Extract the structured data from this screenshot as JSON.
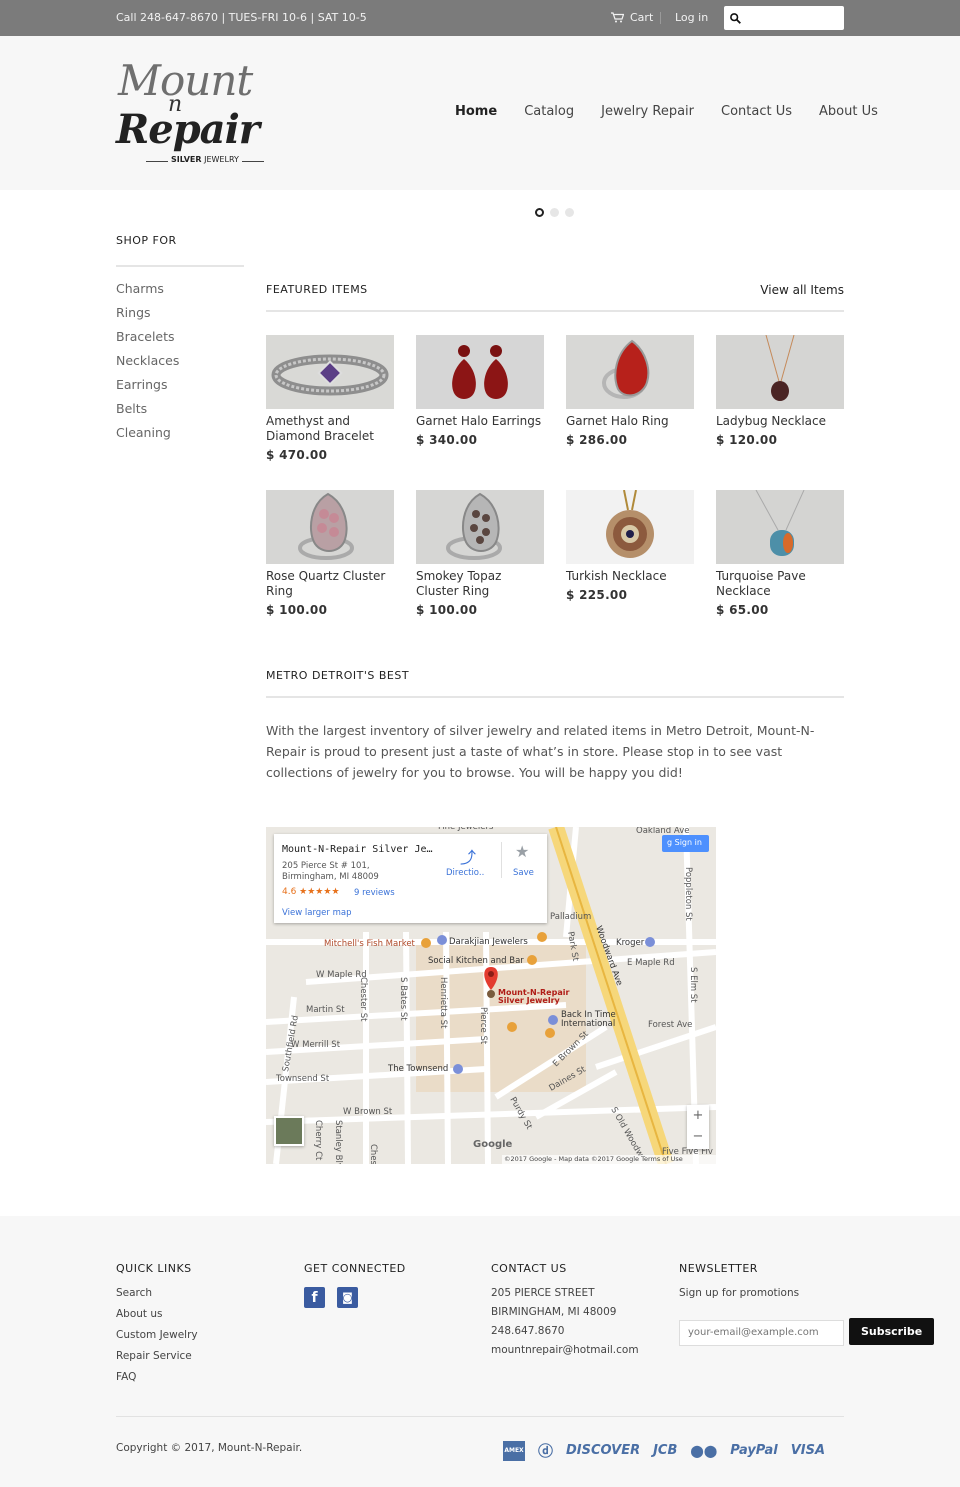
{
  "topbar": {
    "phone": "Call 248-647-8670 | TUES-FRI 10-6 | SAT 10-5",
    "cart_label": "Cart",
    "login_label": "Log in",
    "search_placeholder": ""
  },
  "logo": {
    "line1": "Mount",
    "line2": "n",
    "line3": "Repair",
    "tag_bold": "SILVER",
    "tag_rest": " JEWELRY"
  },
  "nav": {
    "items": [
      "Home",
      "Catalog",
      "Jewelry Repair",
      "Contact Us",
      "About Us"
    ],
    "active": "Home"
  },
  "slider": {
    "dots": 3,
    "active": 0
  },
  "sidebar": {
    "title": "SHOP FOR",
    "items": [
      "Charms",
      "Rings",
      "Bracelets",
      "Necklaces",
      "Earrings",
      "Belts",
      "Cleaning"
    ]
  },
  "featured": {
    "title": "FEATURED ITEMS",
    "view_all": "View all Items",
    "products": [
      {
        "name": "Amethyst and Diamond Bracelet",
        "price": "$ 470.00"
      },
      {
        "name": "Garnet Halo Earrings",
        "price": "$ 340.00"
      },
      {
        "name": "Garnet Halo Ring",
        "price": "$ 286.00"
      },
      {
        "name": "Ladybug Necklace",
        "price": "$ 120.00"
      },
      {
        "name": "Rose Quartz Cluster Ring",
        "price": "$ 100.00"
      },
      {
        "name": "Smokey Topaz Cluster Ring",
        "price": "$ 100.00"
      },
      {
        "name": "Turkish Necklace",
        "price": "$ 225.00"
      },
      {
        "name": "Turquoise Pave Necklace",
        "price": "$ 65.00"
      }
    ]
  },
  "about": {
    "title": "METRO DETROIT'S BEST",
    "text": "With the largest inventory of silver jewelry and related items in Metro Detroit, Mount-N-Repair is proud to present just a taste of what’s in store. Please stop in to see vast collections of jewelry for you to browse. You will be happy you did!"
  },
  "map": {
    "place_name": "Mount-N-Repair Silver Je…",
    "address1": "205 Pierce St # 101,",
    "address2": "Birmingham, MI 48009",
    "rating": "4.6 ★★★★★",
    "reviews": "9 reviews",
    "view_larger": "View larger map",
    "directions": "Directio..",
    "save": "Save",
    "signin": "Sign in",
    "pin_label1": "Mount-N-Repair",
    "pin_label2": "Silver Jewelry",
    "copyright": "©2017 Google - Map data ©2017 Google   Terms of Use",
    "google": "Google",
    "streets": [
      "Oakland Ave",
      "Palladium",
      "Kroger",
      "E Maple Rd",
      "Forest Ave",
      "Mitchell's Fish Market",
      "Darakjian Jewelers",
      "Social Kitchen and Bar",
      "W Maple Rd",
      "Martin St",
      "W Merrill St",
      "Townsend St",
      "The Townsend",
      "W Brown St",
      "Back In Time International",
      "E Brown St",
      "Daines St",
      "Woodward Ave",
      "Pierce St",
      "Henrietta St",
      "S Bates St",
      "Chester St",
      "Southfield Rd",
      "Park St",
      "Purdy St",
      "Poppleton St",
      "S Elm St",
      "S Old Woodw",
      "Five Five Fiv",
      "Stanley Blv",
      "Cherry Ct",
      "Ches",
      "Fine Jewelers"
    ]
  },
  "footer": {
    "quick_links": {
      "title": "QUICK LINKS",
      "items": [
        "Search",
        "About us",
        "Custom Jewelry",
        "Repair Service",
        "FAQ"
      ]
    },
    "connected": {
      "title": "GET CONNECTED"
    },
    "contact": {
      "title": "CONTACT US",
      "lines": [
        "205 PIERCE STREET",
        "BIRMINGHAM, MI 48009",
        "248.647.8670",
        "mountnrepair@hotmail.com"
      ]
    },
    "newsletter": {
      "title": "NEWSLETTER",
      "subtitle": "Sign up for promotions",
      "placeholder": "your-email@example.com",
      "button": "Subscribe"
    },
    "copyright": "Copyright © 2017, Mount-N-Repair.",
    "payments": [
      "AMEX",
      "Diners",
      "DISCOVER",
      "JCB",
      "MasterCard",
      "PayPal",
      "VISA"
    ]
  }
}
